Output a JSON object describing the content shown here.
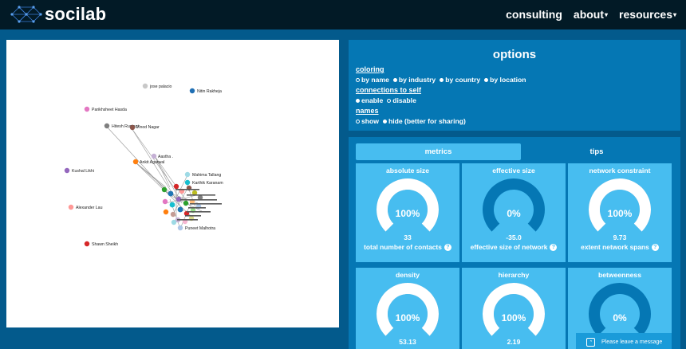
{
  "brand": {
    "name": "socilab"
  },
  "nav": [
    {
      "label": "consulting",
      "dropdown": false
    },
    {
      "label": "about",
      "dropdown": true
    },
    {
      "label": "resources",
      "dropdown": true
    }
  ],
  "graph": {
    "nodes": [
      {
        "label": "jose palacio",
        "color": "#c8c8c8"
      },
      {
        "label": "Nitin Rakheja",
        "color": "#1f6fb4"
      },
      {
        "label": "Parikhsheet Hasda",
        "color": "#e377c2"
      },
      {
        "label": "Hitesh Rustagi",
        "color": "#7f7f7f"
      },
      {
        "label": "Vinod Nagar",
        "color": "#8c564b"
      },
      {
        "label": "Aastha .",
        "color": "#c5b0d5"
      },
      {
        "label": "Ankit Agarwal",
        "color": "#ff7f0e"
      },
      {
        "label": "Kushal Likhi",
        "color": "#9467bd"
      },
      {
        "label": "Mahima Tallang",
        "color": "#9edae5"
      },
      {
        "label": "Karthik Karanam",
        "color": "#17becf"
      },
      {
        "label": "Alexander Lau",
        "color": "#ff9896"
      },
      {
        "label": "Puneet Malhotra",
        "color": "#aec7e8"
      },
      {
        "label": "Shawn Sheikh",
        "color": "#d62728"
      }
    ]
  },
  "options": {
    "title": "options",
    "coloring": {
      "title": "coloring",
      "choices": [
        "by name",
        "by industry",
        "by country",
        "by location"
      ],
      "selected": 0
    },
    "connections": {
      "title": "connections to self",
      "choices": [
        "enable",
        "disable"
      ],
      "selected": 0
    },
    "names": {
      "title": "names",
      "choices": [
        "show",
        "hide (better for sharing)"
      ],
      "selected": 0
    }
  },
  "tabs": {
    "metrics": "metrics",
    "tips": "tips"
  },
  "metrics": [
    {
      "title": "absolute size",
      "pct_label": "100%",
      "fraction": 1.0,
      "value": "33",
      "desc": "total number of contacts"
    },
    {
      "title": "effective size",
      "pct_label": "0%",
      "fraction": 0.0,
      "value": "-35.0",
      "desc": "effective size of network"
    },
    {
      "title": "network constraint",
      "pct_label": "100%",
      "fraction": 1.0,
      "value": "9.73",
      "desc": "extent network spans"
    },
    {
      "title": "density",
      "pct_label": "100%",
      "fraction": 1.0,
      "value": "53.13",
      "desc": ""
    },
    {
      "title": "hierarchy",
      "pct_label": "100%",
      "fraction": 1.0,
      "value": "2.19",
      "desc": ""
    },
    {
      "title": "betweenness",
      "pct_label": "0%",
      "fraction": 0.0,
      "value": "",
      "desc": ""
    }
  ],
  "message_widget": {
    "label": "Please leave a message"
  },
  "colors": {
    "nav_bg": "#021a26",
    "page_bg": "#035a8c",
    "panel_bg": "#0577b4",
    "card_bg": "#47bdf0",
    "gauge_empty": "#0577b4"
  }
}
